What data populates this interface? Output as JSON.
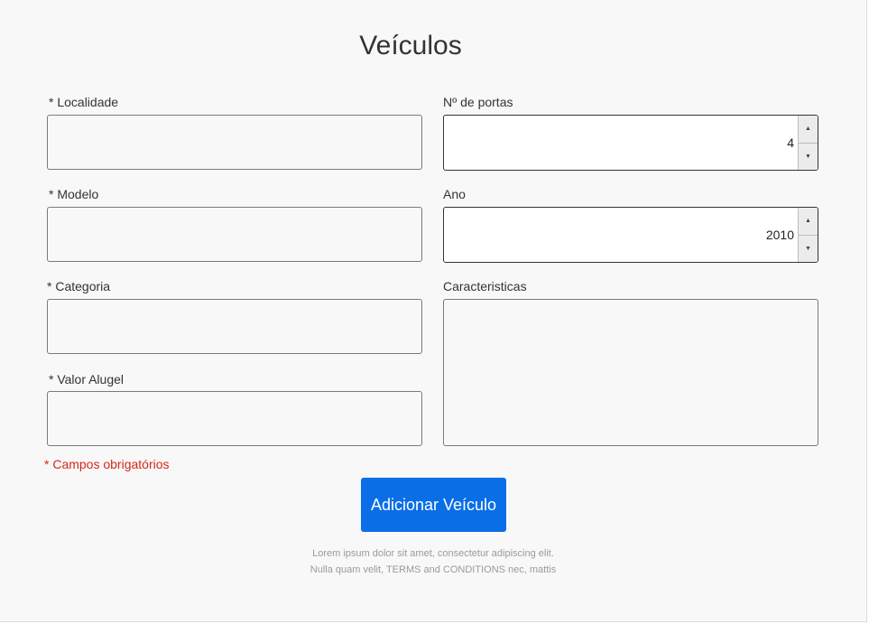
{
  "form": {
    "title": "Veículos",
    "fields": {
      "localidade": {
        "label": "*  Localidade",
        "value": ""
      },
      "modelo": {
        "label": "*  Modelo",
        "value": ""
      },
      "categoria": {
        "label": "* Categoria",
        "value": ""
      },
      "valor_aluguel": {
        "label": "*  Valor Alugel",
        "value": ""
      },
      "portas": {
        "label": "Nº de portas",
        "value": "4"
      },
      "ano": {
        "label": "Ano",
        "value": "2010"
      },
      "caracteristicas": {
        "label": "Caracteristicas",
        "value": ""
      }
    },
    "required_note": "* Campos obrigatórios",
    "submit_label": "Adicionar Veículo"
  },
  "footer": {
    "line1": "Lorem ipsum dolor sit amet, consectetur adipiscing elit.",
    "line2": "Nulla quam velit, TERMS and CONDITIONS nec, mattis"
  },
  "colors": {
    "background": "#f8f8f8",
    "primary_button": "#0a6ee6",
    "required_text": "#d9251c",
    "footer_text": "#9a9a9a"
  },
  "icons": {
    "spinner_up": "triangle-up-icon",
    "spinner_down": "triangle-down-icon"
  }
}
